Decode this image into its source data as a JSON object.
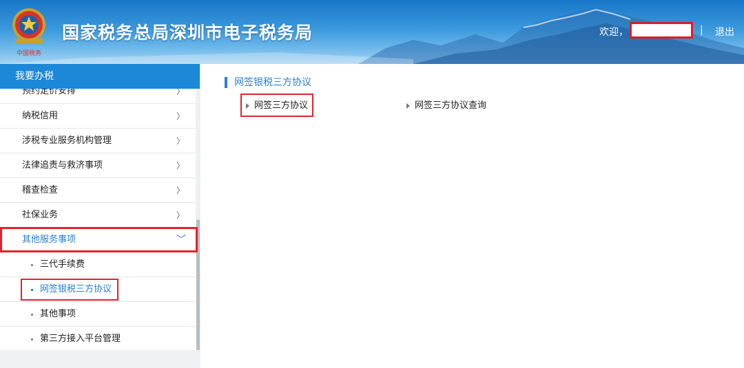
{
  "header": {
    "title": "国家税务总局深圳市电子税务局",
    "welcome": "欢迎，",
    "separator": "|",
    "logout": "退出",
    "logo_caption": "中国税务",
    "colors": {
      "bar": "#1877c9",
      "redact": "#e21b24"
    }
  },
  "sidebar": {
    "title": "我要办税",
    "items": [
      {
        "label": "预约定价安排",
        "chevron": "〉"
      },
      {
        "label": "纳税信用",
        "chevron": "〉"
      },
      {
        "label": "涉税专业服务机构管理",
        "chevron": "〉"
      },
      {
        "label": "法律追责与救济事项",
        "chevron": "〉"
      },
      {
        "label": "稽查检查",
        "chevron": "〉"
      },
      {
        "label": "社保业务",
        "chevron": "〉"
      },
      {
        "label": "其他服务事项",
        "chevron": "﹀"
      }
    ],
    "sub_items": [
      {
        "label": "三代手续费"
      },
      {
        "label": "网签银税三方协议"
      },
      {
        "label": "其他事项"
      },
      {
        "label": "第三方接入平台管理"
      }
    ]
  },
  "main": {
    "section_title": "网签银税三方协议",
    "links": [
      {
        "label": "网签三方协议"
      },
      {
        "label": "网签三方协议查询"
      }
    ]
  }
}
